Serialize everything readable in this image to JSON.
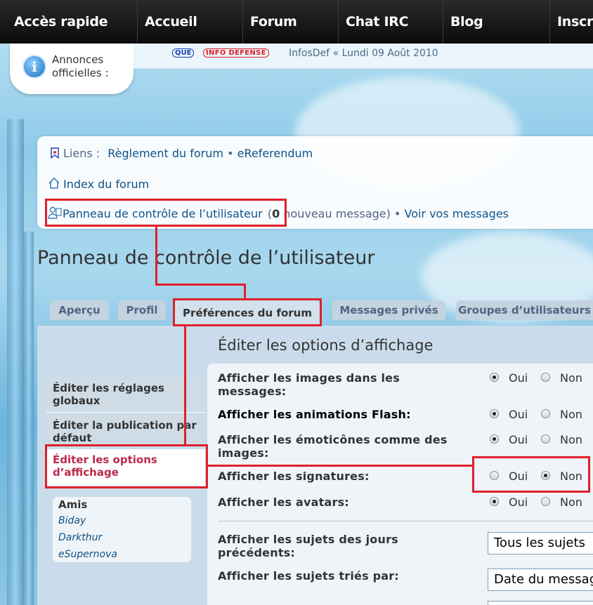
{
  "topnav": {
    "items": [
      "Accès rapide",
      "Accueil",
      "Forum",
      "Chat IRC",
      "Blog",
      "Inscri"
    ]
  },
  "annonce": {
    "icon": "info-icon",
    "line1": "Annonces",
    "line2": "officielles :"
  },
  "ticker": {
    "tag1": "QUE",
    "tag2": "INFO DEFENSE",
    "text": "InfosDef « Lundi 09 Août 2010"
  },
  "links": {
    "liens_label": "Liens :",
    "reglement": "Règlement du forum",
    "bullet": "•",
    "ereferendum": "eReferendum",
    "index": "Index du forum",
    "ucp": "Panneau de contrôle de l’utilisateur",
    "msg_open": "(",
    "msg_count": "0",
    "msg_suffix": "nouveau message)",
    "voir": "Voir vos messages"
  },
  "page_title": "Panneau de contrôle de l’utilisateur",
  "tabs": [
    "Aperçu",
    "Profil",
    "Préférences du forum",
    "Messages privés",
    "Groupes d’utilisateurs"
  ],
  "left_menu": [
    "Éditer les réglages globaux",
    "Éditer la publication par défaut",
    "Éditer les options d’affichage"
  ],
  "friends": {
    "title": "Amis",
    "items": [
      "Biday",
      "Darkthur",
      "eSupernova"
    ]
  },
  "section_title": "Éditer les options d’affichage",
  "options": [
    {
      "label": "Afficher les images dans les messages:",
      "value": "Oui"
    },
    {
      "label": "Afficher les animations Flash:",
      "value": "Oui"
    },
    {
      "label": "Afficher les émoticônes comme des images:",
      "value": "Oui"
    },
    {
      "label": "Afficher les signatures:",
      "value": "Non"
    },
    {
      "label": "Afficher les avatars:",
      "value": "Oui"
    }
  ],
  "radio_yes": "Oui",
  "radio_no": "Non",
  "selects": [
    {
      "label": "Afficher les sujets des jours précédents:",
      "value": "Tous les sujets"
    },
    {
      "label": "Afficher les sujets triés par:",
      "value": "Date du message"
    }
  ],
  "colors": {
    "highlight": "#e0202a",
    "link": "#105289",
    "active_menu": "#bc2a4d"
  }
}
